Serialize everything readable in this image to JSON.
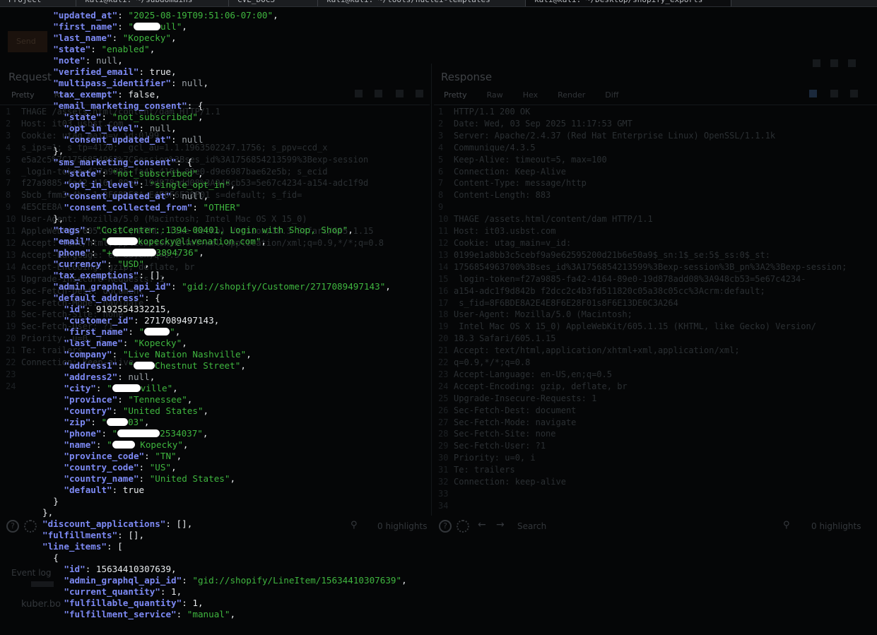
{
  "tabs": [
    {
      "label": "Project"
    },
    {
      "label": "kali@kali: ~/subdomains"
    },
    {
      "label": "CVE_DOCS"
    },
    {
      "label": "kali@kali: ~/tools/nuclei-templates"
    },
    {
      "label": "kali@kali: ~/Desktop/shopify_exports"
    }
  ],
  "background_app": {
    "send_label": "Send",
    "request_title": "Request",
    "response_title": "Response",
    "request_subtabs": [
      "Pretty",
      "Raw",
      "Hex"
    ],
    "response_subtabs": [
      "Pretty",
      "Raw",
      "Hex",
      "Render",
      "Diff"
    ],
    "request_lines": [
      "THAGE /assets.html/content/dam HTTP/1.1",
      "Host: it03.usbst.com",
      "Cookie: utag_main=v_id:0199",
      "s_ips=1; s_tp=4120; _gcl_au=1.1.1963502247.1756; s_ppv=ccd_x",
      "e5a2c5%7C1756854963%7CSession%3Bses_id%3A1756854213599%3Bexp-session",
      "_login-token=f27a9885-fa42-4164-89e0-d9e6987bae62e5b; s_ecid",
      "f27a9885-fa42-4164-89e0-19d878add08%3A948cb53=5e67c4234-a154-adc1f9d",
      "Sbcb_fmm3=4b; 1=8F6BDE8A:E4E8F6E28F01 s=default; s_fid=",
      "4E5CEE8A",
      "User-Agent: Mozilla/5.0 (Macintosh; Intel Mac OS X 15_0)",
      "AppleWebKit/605.1.15 (KHTML, like Gecko) Version/18.3 Safari/605.1.15",
      "Accept: text/html,application/xhtml+xml,application/xml;q=0.9,*/*;q=0.8",
      "Accept-Language: en-US,en;q=0.5",
      "Accept-Encoding: gzip, deflate, br",
      "Upgrade-Insecure-Requests: 1",
      "Sec-Fetch-Dest: document",
      "Sec-Fetch-Mode: navigate",
      "Sec-Fetch-Site: none",
      "Sec-Fetch-User: ?1",
      "Priority: u=0, i",
      "Te: trailers",
      "Connection: keep-alive",
      "",
      ""
    ],
    "response_lines": [
      "HTTP/1.1 200 OK",
      "Date: Wed, 03 Sep 2025 11:17:53 GMT",
      "Server: Apache/2.4.37 (Red Hat Enterprise Linux) OpenSSL/1.1.1k",
      "Communique/4.3.5",
      "Keep-Alive: timeout=5, max=100",
      "Connection: Keep-Alive",
      "Content-Type: message/http",
      "Content-Length: 883",
      "",
      "THAGE /assets.html/content/dam HTTP/1.1",
      "Host: it03.usbst.com",
      "Cookie: utag_main=v_id:",
      "0199e1a8bb3c5cebf9a9e62595200d21b6e50a9$_sn:1$_se:5$_ss:0$_st:",
      "1756854963700%3Bses_id%3A1756854213599%3Bexp-session%3B_pn%3A2%3Bexp-session;",
      " login-token=f27a9885-fa42-4164-89e0-19d878add08%3A948cb53=5e67c4234-",
      "a154-adc1f9d842b f2dcc2c4b3fd511820c05a38c05cc%3Acrm:default;",
      " s_fid=8F6BDE8A2E4E8F6E28F01s8F6E13DE0C3A264",
      "User-Agent: Mozilla/5.0 (Macintosh;",
      " Intel Mac OS X 15_0) AppleWebKit/605.1.15 (KHTML, like Gecko) Version/",
      "18.3 Safari/605.1.15",
      "Accept: text/html,application/xhtml+xml,application/xml;",
      "q=0.9,*/*;q=0.8",
      "Accept-Language: en-US,en;q=0.5",
      "Accept-Encoding: gzip, deflate, br",
      "Upgrade-Insecure-Requests: 1",
      "Sec-Fetch-Dest: document",
      "Sec-Fetch-Mode: navigate",
      "Sec-Fetch-Site: none",
      "Sec-Fetch-User: ?1",
      "Priority: u=0, i",
      "Te: trailers",
      "Connection: keep-alive",
      "",
      ""
    ],
    "search_placeholder": "Search",
    "highlights_label": "0 highlights",
    "event_log_label": "Event log",
    "bottom_label": "kuber.bo"
  },
  "terminal": {
    "lines": [
      {
        "indent": 8,
        "parts": [
          [
            "k",
            "\"updated_at\""
          ],
          [
            "p",
            ": "
          ],
          [
            "s",
            "\"2025-08-19T09:51:06-07:00\""
          ],
          [
            "p",
            ","
          ]
        ]
      },
      {
        "indent": 8,
        "parts": [
          [
            "k",
            "\"first_name\""
          ],
          [
            "p",
            ": "
          ],
          [
            "s",
            "\""
          ],
          [
            "r",
            38
          ],
          [
            "s",
            "ull\""
          ],
          [
            "p",
            ","
          ]
        ]
      },
      {
        "indent": 8,
        "parts": [
          [
            "k",
            "\"last_name\""
          ],
          [
            "p",
            ": "
          ],
          [
            "s",
            "\"Kopecky\""
          ],
          [
            "p",
            ","
          ]
        ]
      },
      {
        "indent": 8,
        "parts": [
          [
            "k",
            "\"state\""
          ],
          [
            "p",
            ": "
          ],
          [
            "s",
            "\"enabled\""
          ],
          [
            "p",
            ","
          ]
        ]
      },
      {
        "indent": 8,
        "parts": [
          [
            "k",
            "\"note\""
          ],
          [
            "p",
            ": "
          ],
          [
            "n",
            "null"
          ],
          [
            "p",
            ","
          ]
        ]
      },
      {
        "indent": 8,
        "parts": [
          [
            "k",
            "\"verified_email\""
          ],
          [
            "p",
            ": true,"
          ]
        ]
      },
      {
        "indent": 8,
        "parts": [
          [
            "k",
            "\"multipass_identifier\""
          ],
          [
            "p",
            ": "
          ],
          [
            "n",
            "null"
          ],
          [
            "p",
            ","
          ]
        ]
      },
      {
        "indent": 8,
        "parts": [
          [
            "k",
            "\"tax_exempt\""
          ],
          [
            "p",
            ": false,"
          ]
        ]
      },
      {
        "indent": 8,
        "parts": [
          [
            "k",
            "\"email_marketing_consent\""
          ],
          [
            "p",
            ": {"
          ]
        ]
      },
      {
        "indent": 10,
        "parts": [
          [
            "k",
            "\"state\""
          ],
          [
            "p",
            ": "
          ],
          [
            "s",
            "\"not_subscribed\""
          ],
          [
            "p",
            ","
          ]
        ]
      },
      {
        "indent": 10,
        "parts": [
          [
            "k",
            "\"opt_in_level\""
          ],
          [
            "p",
            ": "
          ],
          [
            "n",
            "null"
          ],
          [
            "p",
            ","
          ]
        ]
      },
      {
        "indent": 10,
        "parts": [
          [
            "k",
            "\"consent_updated_at\""
          ],
          [
            "p",
            ": "
          ],
          [
            "n",
            "null"
          ]
        ]
      },
      {
        "indent": 8,
        "parts": [
          [
            "p",
            "},"
          ]
        ]
      },
      {
        "indent": 8,
        "parts": [
          [
            "k",
            "\"sms_marketing_consent\""
          ],
          [
            "p",
            ": {"
          ]
        ]
      },
      {
        "indent": 10,
        "parts": [
          [
            "k",
            "\"state\""
          ],
          [
            "p",
            ": "
          ],
          [
            "s",
            "\"not_subscribed\""
          ],
          [
            "p",
            ","
          ]
        ]
      },
      {
        "indent": 10,
        "parts": [
          [
            "k",
            "\"opt_in_level\""
          ],
          [
            "p",
            ": "
          ],
          [
            "s",
            "\"single_opt_in\""
          ],
          [
            "p",
            ","
          ]
        ]
      },
      {
        "indent": 10,
        "parts": [
          [
            "k",
            "\"consent_updated_at\""
          ],
          [
            "p",
            ": "
          ],
          [
            "n",
            "null"
          ],
          [
            "p",
            ","
          ]
        ]
      },
      {
        "indent": 10,
        "parts": [
          [
            "k",
            "\"consent_collected_from\""
          ],
          [
            "p",
            ": "
          ],
          [
            "s",
            "\"OTHER\""
          ]
        ]
      },
      {
        "indent": 8,
        "parts": [
          [
            "p",
            "},"
          ]
        ]
      },
      {
        "indent": 8,
        "parts": [
          [
            "k",
            "\"tags\""
          ],
          [
            "p",
            ": "
          ],
          [
            "s",
            "\"CostCenter::1394-00401, Login with Shop, Shop\""
          ],
          [
            "p",
            ","
          ]
        ]
      },
      {
        "indent": 8,
        "parts": [
          [
            "k",
            "\"email\""
          ],
          [
            "p",
            ": "
          ],
          [
            "s",
            "\""
          ],
          [
            "r",
            44
          ],
          [
            "s",
            "kopecky@livenation.com\""
          ],
          [
            "p",
            ","
          ]
        ]
      },
      {
        "indent": 8,
        "parts": [
          [
            "k",
            "\"phone\""
          ],
          [
            "p",
            ": "
          ],
          [
            "s",
            "\"+"
          ],
          [
            "r",
            62
          ],
          [
            "s",
            "3894736\""
          ],
          [
            "p",
            ","
          ]
        ]
      },
      {
        "indent": 8,
        "parts": [
          [
            "k",
            "\"currency\""
          ],
          [
            "p",
            ": "
          ],
          [
            "s",
            "\"USD\""
          ],
          [
            "p",
            ","
          ]
        ]
      },
      {
        "indent": 8,
        "parts": [
          [
            "k",
            "\"tax_exemptions\""
          ],
          [
            "p",
            ": [],"
          ]
        ]
      },
      {
        "indent": 8,
        "parts": [
          [
            "k",
            "\"admin_graphql_api_id\""
          ],
          [
            "p",
            ": "
          ],
          [
            "s",
            "\"gid://shopify/Customer/2717089497143\""
          ],
          [
            "p",
            ","
          ]
        ]
      },
      {
        "indent": 8,
        "parts": [
          [
            "k",
            "\"default_address\""
          ],
          [
            "p",
            ": {"
          ]
        ]
      },
      {
        "indent": 10,
        "parts": [
          [
            "k",
            "\"id\""
          ],
          [
            "p",
            ": 9192554332215,"
          ]
        ]
      },
      {
        "indent": 10,
        "parts": [
          [
            "k",
            "\"customer_id\""
          ],
          [
            "p",
            ": 2717089497143,"
          ]
        ]
      },
      {
        "indent": 10,
        "parts": [
          [
            "k",
            "\"first_name\""
          ],
          [
            "p",
            ": "
          ],
          [
            "s",
            "\""
          ],
          [
            "r",
            36
          ],
          [
            "s",
            "\""
          ],
          [
            "p",
            ","
          ]
        ]
      },
      {
        "indent": 10,
        "parts": [
          [
            "k",
            "\"last_name\""
          ],
          [
            "p",
            ": "
          ],
          [
            "s",
            "\"Kopecky\""
          ],
          [
            "p",
            ","
          ]
        ]
      },
      {
        "indent": 10,
        "parts": [
          [
            "k",
            "\"company\""
          ],
          [
            "p",
            ": "
          ],
          [
            "s",
            "\"Live Nation Nashville\""
          ],
          [
            "p",
            ","
          ]
        ]
      },
      {
        "indent": 10,
        "parts": [
          [
            "k",
            "\"address1\""
          ],
          [
            "p",
            ": "
          ],
          [
            "s",
            "\""
          ],
          [
            "r",
            30
          ],
          [
            "s",
            "Chestnut Street\""
          ],
          [
            "p",
            ","
          ]
        ]
      },
      {
        "indent": 10,
        "parts": [
          [
            "k",
            "\"address2\""
          ],
          [
            "p",
            ": "
          ],
          [
            "n",
            "null"
          ],
          [
            "p",
            ","
          ]
        ]
      },
      {
        "indent": 10,
        "parts": [
          [
            "k",
            "\"city\""
          ],
          [
            "p",
            ": "
          ],
          [
            "s",
            "\""
          ],
          [
            "r",
            40
          ],
          [
            "s",
            "ville\""
          ],
          [
            "p",
            ","
          ]
        ]
      },
      {
        "indent": 10,
        "parts": [
          [
            "k",
            "\"province\""
          ],
          [
            "p",
            ": "
          ],
          [
            "s",
            "\"Tennessee\""
          ],
          [
            "p",
            ","
          ]
        ]
      },
      {
        "indent": 10,
        "parts": [
          [
            "k",
            "\"country\""
          ],
          [
            "p",
            ": "
          ],
          [
            "s",
            "\"United States\""
          ],
          [
            "p",
            ","
          ]
        ]
      },
      {
        "indent": 10,
        "parts": [
          [
            "k",
            "\"zip\""
          ],
          [
            "p",
            ": "
          ],
          [
            "s",
            "\""
          ],
          [
            "r",
            30
          ],
          [
            "s",
            "03\""
          ],
          [
            "p",
            ","
          ]
        ]
      },
      {
        "indent": 10,
        "parts": [
          [
            "k",
            "\"phone\""
          ],
          [
            "p",
            ": "
          ],
          [
            "s",
            "\""
          ],
          [
            "r",
            60
          ],
          [
            "s",
            "2534037\""
          ],
          [
            "p",
            ","
          ]
        ]
      },
      {
        "indent": 10,
        "parts": [
          [
            "k",
            "\"name\""
          ],
          [
            "p",
            ": "
          ],
          [
            "s",
            "\""
          ],
          [
            "r",
            32
          ],
          [
            "s",
            " Kopecky\""
          ],
          [
            "p",
            ","
          ]
        ]
      },
      {
        "indent": 10,
        "parts": [
          [
            "k",
            "\"province_code\""
          ],
          [
            "p",
            ": "
          ],
          [
            "s",
            "\"TN\""
          ],
          [
            "p",
            ","
          ]
        ]
      },
      {
        "indent": 10,
        "parts": [
          [
            "k",
            "\"country_code\""
          ],
          [
            "p",
            ": "
          ],
          [
            "s",
            "\"US\""
          ],
          [
            "p",
            ","
          ]
        ]
      },
      {
        "indent": 10,
        "parts": [
          [
            "k",
            "\"country_name\""
          ],
          [
            "p",
            ": "
          ],
          [
            "s",
            "\"United States\""
          ],
          [
            "p",
            ","
          ]
        ]
      },
      {
        "indent": 10,
        "parts": [
          [
            "k",
            "\"default\""
          ],
          [
            "p",
            ": true"
          ]
        ]
      },
      {
        "indent": 8,
        "parts": [
          [
            "p",
            "}"
          ]
        ]
      },
      {
        "indent": 6,
        "parts": [
          [
            "p",
            "},"
          ]
        ]
      },
      {
        "indent": 6,
        "parts": [
          [
            "k",
            "\"discount_applications\""
          ],
          [
            "p",
            ": [],"
          ]
        ]
      },
      {
        "indent": 6,
        "parts": [
          [
            "k",
            "\"fulfillments\""
          ],
          [
            "p",
            ": [],"
          ]
        ]
      },
      {
        "indent": 6,
        "parts": [
          [
            "k",
            "\"line_items\""
          ],
          [
            "p",
            ": ["
          ]
        ]
      },
      {
        "indent": 8,
        "parts": [
          [
            "p",
            "{"
          ]
        ]
      },
      {
        "indent": 10,
        "parts": [
          [
            "k",
            "\"id\""
          ],
          [
            "p",
            ": 15634410307639,"
          ]
        ]
      },
      {
        "indent": 10,
        "parts": [
          [
            "k",
            "\"admin_graphql_api_id\""
          ],
          [
            "p",
            ": "
          ],
          [
            "s",
            "\"gid://shopify/LineItem/15634410307639\""
          ],
          [
            "p",
            ","
          ]
        ]
      },
      {
        "indent": 10,
        "parts": [
          [
            "k",
            "\"current_quantity\""
          ],
          [
            "p",
            ": 1,"
          ]
        ]
      },
      {
        "indent": 10,
        "parts": [
          [
            "k",
            "\"fulfillable_quantity\""
          ],
          [
            "p",
            ": 1,"
          ]
        ]
      },
      {
        "indent": 10,
        "parts": [
          [
            "k",
            "\"fulfillment_service\""
          ],
          [
            "p",
            ": "
          ],
          [
            "s",
            "\"manual\""
          ],
          [
            "p",
            ","
          ]
        ]
      }
    ]
  }
}
